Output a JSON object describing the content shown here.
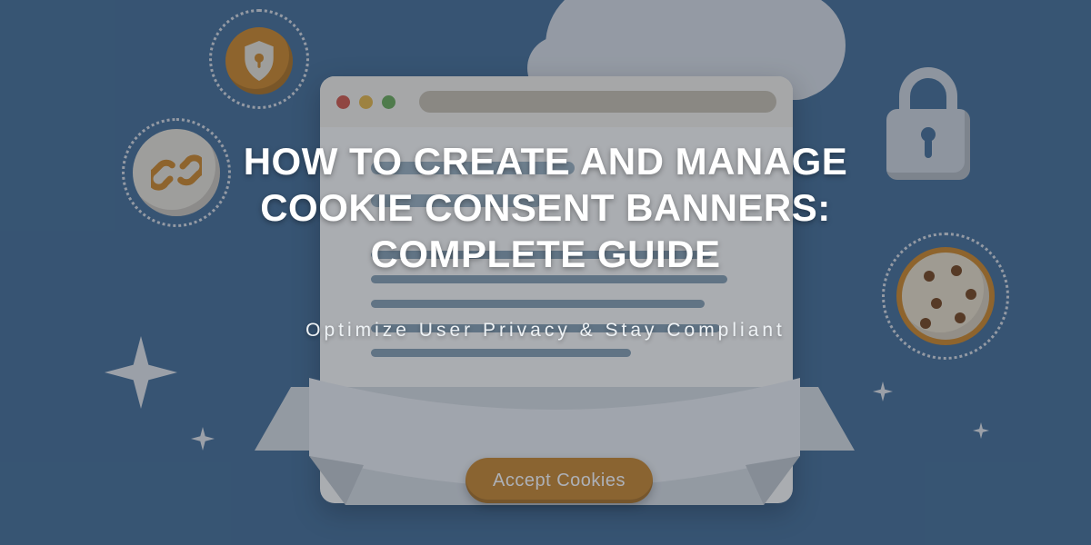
{
  "headline": {
    "title": "HOW TO CREATE AND MANAGE COOKIE CONSENT BANNERS: COMPLETE GUIDE",
    "subtitle": "Optimize User Privacy & Stay Compliant"
  },
  "illustration": {
    "accept_button_label": "Accept Cookies"
  },
  "icons": {
    "shield": "shield-icon",
    "link": "chain-link-icon",
    "lock": "lock-icon",
    "cookie": "cookie-icon",
    "sparkle": "sparkle-icon",
    "cloud": "cloud-icon"
  },
  "colors": {
    "background": "#4a7298",
    "accent": "#c98a33",
    "light": "#e9e3d7",
    "text": "#ffffff"
  }
}
